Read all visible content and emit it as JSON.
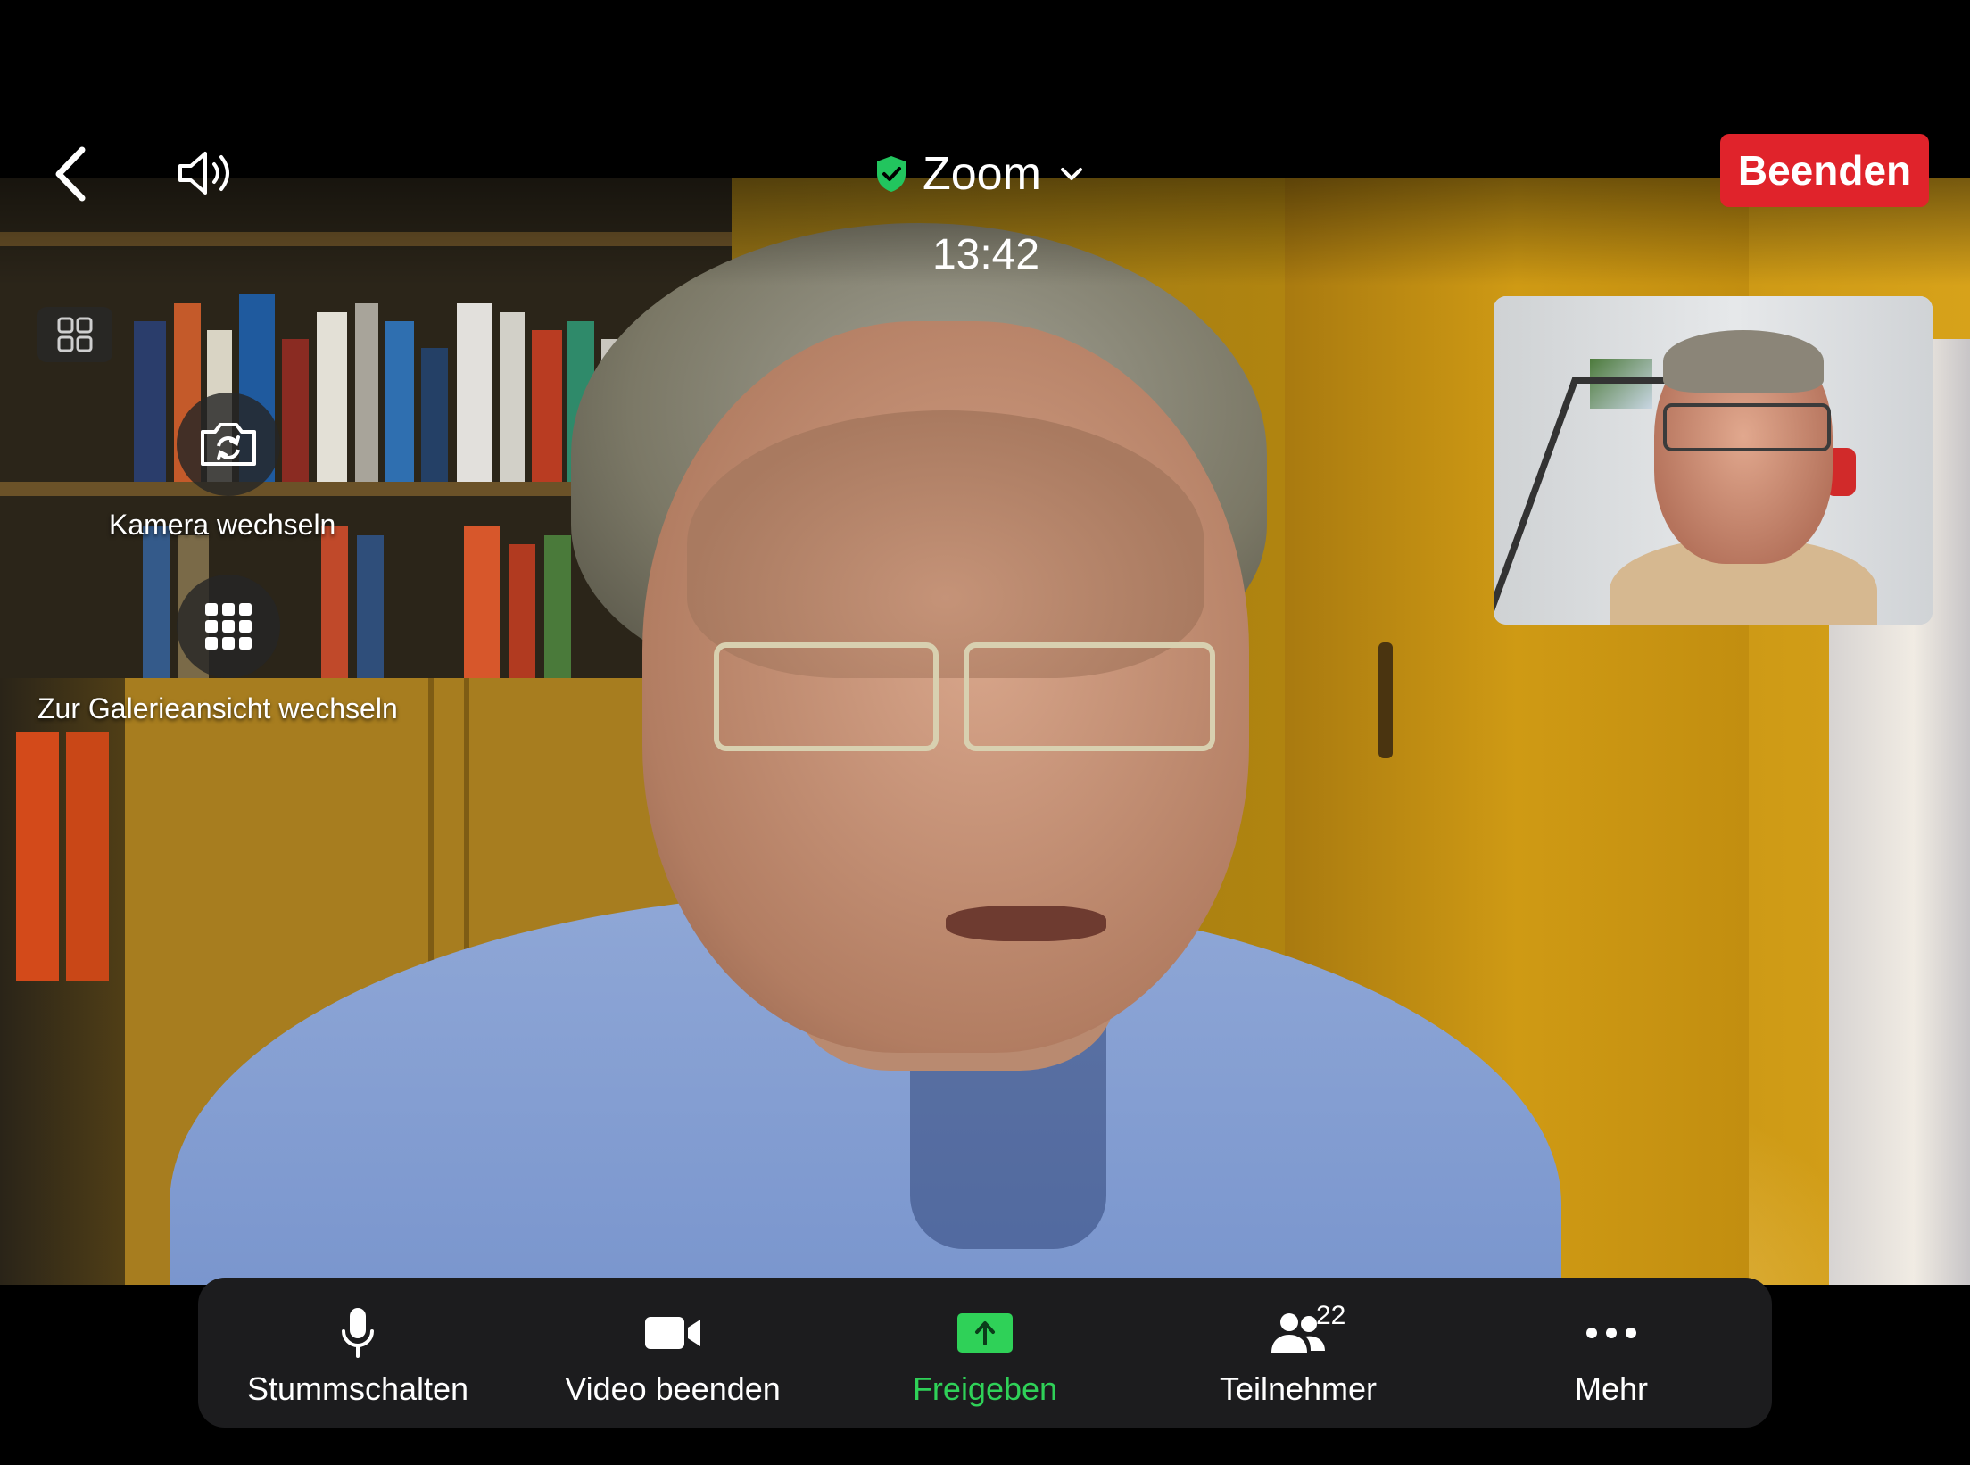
{
  "meeting": {
    "title": "Zoom",
    "time": "13:42",
    "end_label": "Beenden"
  },
  "overlay": {
    "switch_camera_label": "Kamera wechseln",
    "gallery_view_label": "Zur Galerieansicht wechseln"
  },
  "toolbar": {
    "mute_label": "Stummschalten",
    "stop_video_label": "Video beenden",
    "share_label": "Freigeben",
    "participants_label": "Teilnehmer",
    "participants_count": "22",
    "more_label": "Mehr"
  },
  "icons": {
    "back": "chevron-left-icon",
    "speaker": "speaker-icon",
    "security": "shield-check-icon",
    "title_dropdown": "chevron-down-icon",
    "layout": "grid-2x2-icon",
    "switch_camera": "camera-switch-icon",
    "gallery": "grid-3x3-icon",
    "mute": "microphone-icon",
    "video": "video-camera-icon",
    "share": "share-upload-icon",
    "participants": "people-icon",
    "more": "ellipsis-icon"
  },
  "colors": {
    "end_button": "#e0232b",
    "share_green": "#2fd158",
    "toolbar_bg": "#1c1c1e",
    "security_green": "#22c55e"
  }
}
